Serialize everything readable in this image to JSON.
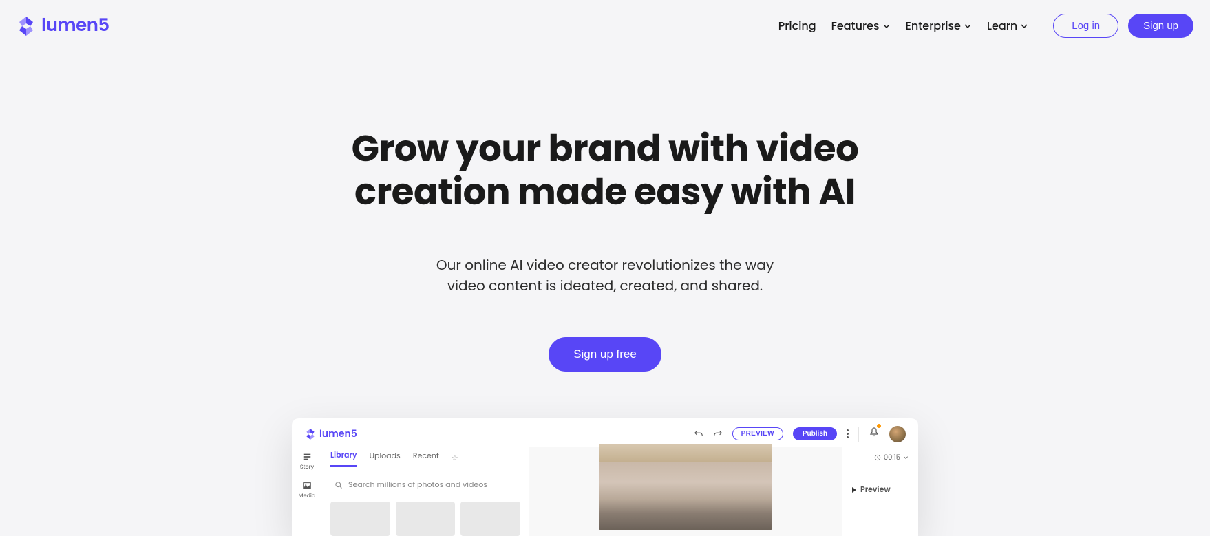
{
  "brand": "lumen5",
  "nav": {
    "pricing": "Pricing",
    "features": "Features",
    "enterprise": "Enterprise",
    "learn": "Learn",
    "login": "Log in",
    "signup": "Sign up"
  },
  "hero": {
    "headline_l1": "Grow your brand with video",
    "headline_l2": "creation made easy with AI",
    "sub_l1": "Our online AI video creator revolutionizes the way",
    "sub_l2": "video content is ideated, created, and shared.",
    "cta": "Sign up free"
  },
  "editor": {
    "brand": "lumen5",
    "preview_btn": "PREVIEW",
    "publish_btn": "Publish",
    "rail": {
      "story": "Story",
      "media": "Media"
    },
    "tabs": {
      "library": "Library",
      "uploads": "Uploads",
      "recent": "Recent"
    },
    "search_placeholder": "Search millions of photos and videos",
    "time": "00:15",
    "preview_label": "Preview"
  }
}
